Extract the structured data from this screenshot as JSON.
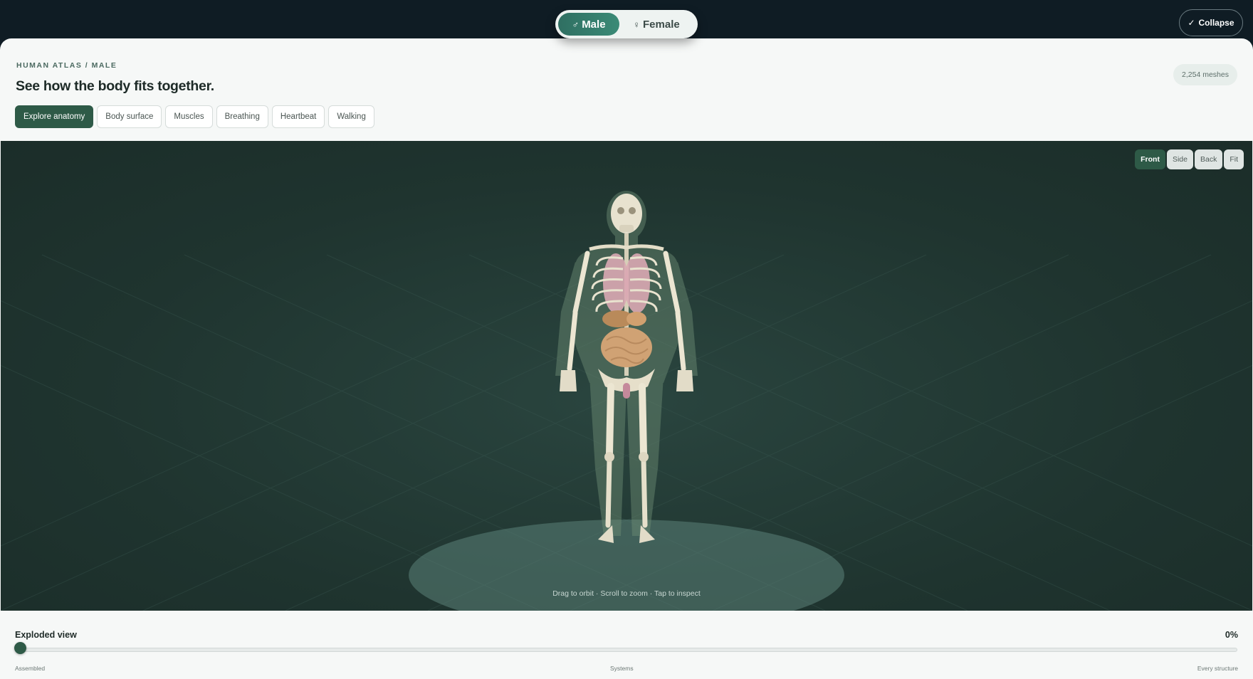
{
  "gender_toggle": {
    "male": {
      "symbol": "♂",
      "label": "Male"
    },
    "female": {
      "symbol": "♀",
      "label": "Female"
    }
  },
  "collapse": {
    "icon": "✓",
    "label": "Collapse"
  },
  "header": {
    "breadcrumb": "HUMAN ATLAS / MALE",
    "title": "See how the body fits together.",
    "mesh_count": "2,254 meshes"
  },
  "tabs": [
    {
      "label": "Explore anatomy",
      "active": true
    },
    {
      "label": "Body surface"
    },
    {
      "label": "Muscles"
    },
    {
      "label": "Breathing"
    },
    {
      "label": "Heartbeat"
    },
    {
      "label": "Walking"
    }
  ],
  "views": [
    {
      "label": "Front",
      "active": true
    },
    {
      "label": "Side"
    },
    {
      "label": "Back"
    },
    {
      "label": "Fit"
    }
  ],
  "viewport": {
    "hint": "Drag to orbit · Scroll to zoom · Tap to inspect"
  },
  "explode": {
    "title": "Exploded view",
    "value_label": "0%",
    "value": 0,
    "stops": [
      "Assembled",
      "Systems",
      "Every structure"
    ]
  },
  "colors": {
    "accent": "#2e5a47",
    "viewport_bg": "#1f342f",
    "app_bg": "#0f1c24"
  }
}
